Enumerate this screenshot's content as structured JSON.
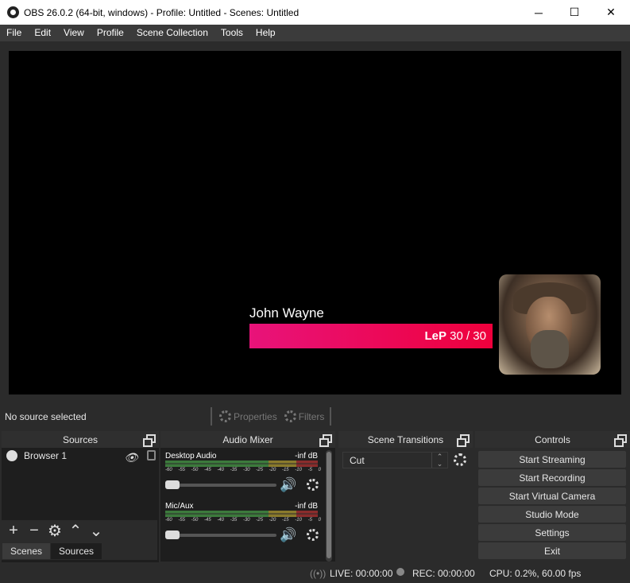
{
  "window": {
    "title": "OBS 26.0.2 (64-bit, windows) - Profile: Untitled - Scenes: Untitled",
    "minimize": "─",
    "maximize": "☐",
    "close": "✕"
  },
  "menu": [
    "File",
    "Edit",
    "View",
    "Profile",
    "Scene Collection",
    "Tools",
    "Help"
  ],
  "preview": {
    "name": "John Wayne",
    "stat_label": "LeP",
    "stat_value": "30 / 30"
  },
  "status": {
    "no_source": "No source selected",
    "properties": "Properties",
    "filters": "Filters"
  },
  "sources": {
    "title": "Sources",
    "items": [
      {
        "name": "Browser 1"
      }
    ],
    "tabs": [
      "Scenes",
      "Sources"
    ]
  },
  "mixer": {
    "title": "Audio Mixer",
    "channels": [
      {
        "name": "Desktop Audio",
        "db": "-inf dB"
      },
      {
        "name": "Mic/Aux",
        "db": "-inf dB"
      }
    ],
    "ticks": [
      "-60",
      "-55",
      "-50",
      "-45",
      "-40",
      "-35",
      "-30",
      "-25",
      "-20",
      "-15",
      "-10",
      "-5",
      "0"
    ]
  },
  "transitions": {
    "title": "Scene Transitions",
    "selected": "Cut"
  },
  "controls": {
    "title": "Controls",
    "buttons": [
      "Start Streaming",
      "Start Recording",
      "Start Virtual Camera",
      "Studio Mode",
      "Settings",
      "Exit"
    ]
  },
  "footer": {
    "live": "LIVE: 00:00:00",
    "rec": "REC: 00:00:00",
    "cpu": "CPU: 0.2%, 60.00 fps"
  }
}
